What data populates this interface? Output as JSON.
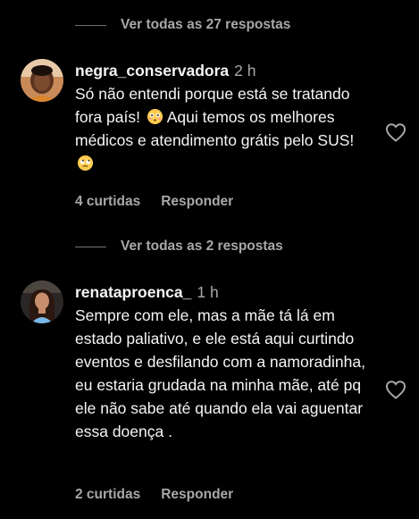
{
  "thread1": {
    "view_replies": "Ver todas as 27 respostas"
  },
  "comment1": {
    "username": "negra_conservadora",
    "time": "2 h",
    "text_parts": [
      "Só não entendi porque está se tratando fora país! ",
      " Aqui temos os melhores médicos e atendimento grátis pelo SUS! "
    ],
    "emoji_1": "flushed-face",
    "emoji_2": "face-with-rolling-eyes",
    "likes": "4 curtidas",
    "reply": "Responder"
  },
  "thread2": {
    "view_replies": "Ver todas as 2 respostas"
  },
  "comment2": {
    "username": "renataproenca_",
    "time": "1 h",
    "text": "Sempre com ele, mas a mãe tá lá em estado paliativo, e ele está aqui curtindo eventos e desfilando com a namoradinha, eu estaria grudada na minha mãe, até pq ele não sabe até quando ela vai aguentar essa doença .",
    "likes": "2 curtidas",
    "reply": "Responder"
  },
  "colors": {
    "background": "#000000",
    "primary_text": "#f5f5f5",
    "secondary_text": "#a8a8a8",
    "divider": "#737373"
  }
}
